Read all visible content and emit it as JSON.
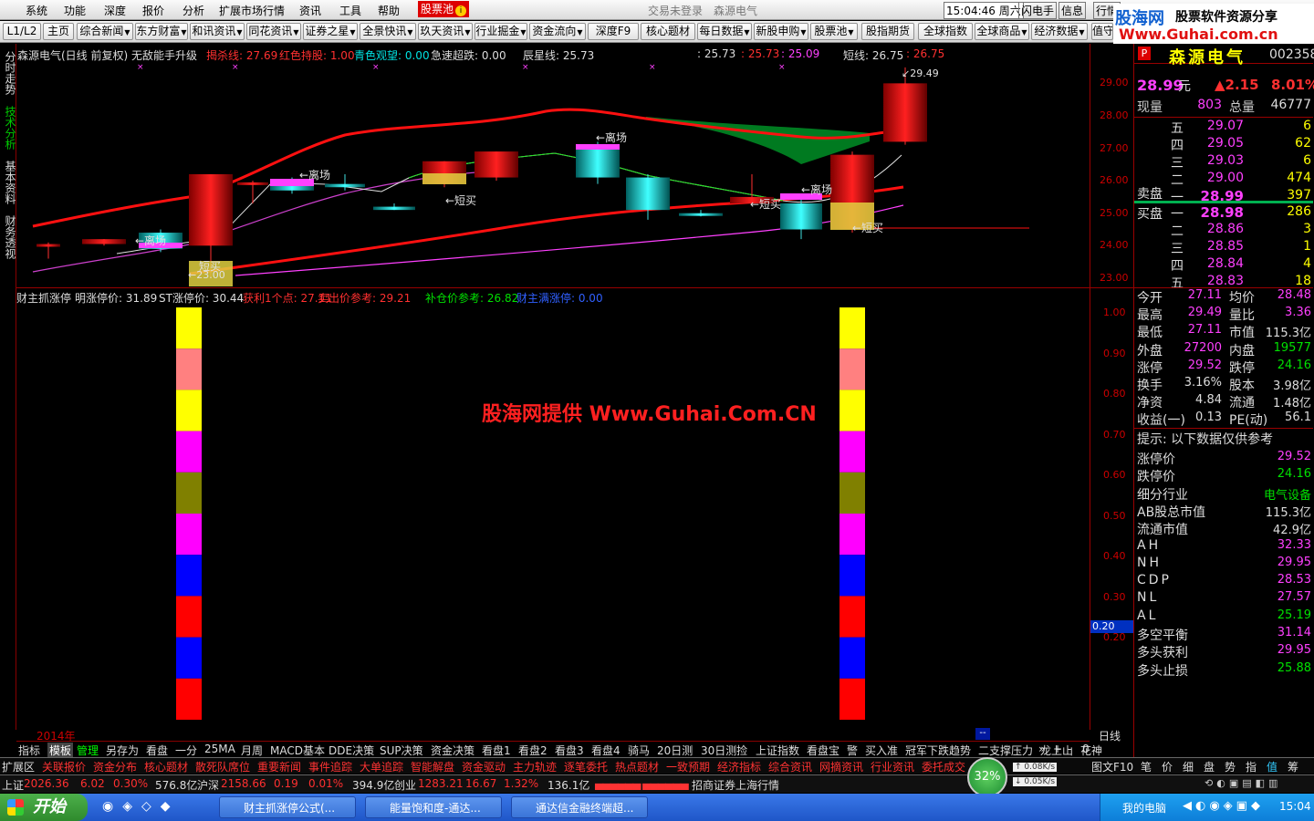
{
  "menu": {
    "items": [
      "系统",
      "功能",
      "深度",
      "报价",
      "分析",
      "扩展市场行情",
      "资讯",
      "工具",
      "帮助"
    ],
    "hot_item": "股票池",
    "center_status": "交易未登录",
    "center_stock": "森源电气",
    "time": "15:04:46 周六",
    "right_items": [
      "闪电手",
      "信息",
      "行情"
    ]
  },
  "toolbar": {
    "items": [
      "L1/L2",
      "主页",
      "综合新闻",
      "东方财富",
      "和讯资讯",
      "同花资讯",
      "证券之星",
      "全景快讯",
      "玖天资讯",
      "行业掘金",
      "资金流向",
      "深度F9",
      "核心题材",
      "每日数据",
      "新股申购",
      "股票池",
      "股指期货",
      "全球指数",
      "全球商品",
      "经济数据",
      "值守"
    ]
  },
  "logo": {
    "brand": "股海网",
    "slogan": "股票软件资源分享",
    "url": "Www.Guhai.com.cn"
  },
  "left_tabs": [
    "分时走势",
    "技术分析",
    "基本资料",
    "财务透视"
  ],
  "kline": {
    "header": [
      {
        "t": "森源电气(日线 前复权) 无敌能手升级",
        "c": "#ddd"
      },
      {
        "t": "揭杀线: 27.69",
        "c": "#ff3030"
      },
      {
        "t": "红色持股: 1.00",
        "c": "#ff3030"
      },
      {
        "t": "青色观望: 0.00",
        "c": "#00e0e0"
      },
      {
        "t": "急速超跌: 0.00",
        "c": "#ddd"
      },
      {
        "t": "辰星线: 25.73",
        "c": "#ddd"
      },
      {
        "t": ": 25.73",
        "c": "#ddd"
      },
      {
        "t": ": 25.73",
        "c": "#ff3030"
      },
      {
        "t": ": 25.09",
        "c": "#ff40ff"
      },
      {
        "t": "短线: 26.75",
        "c": "#ddd"
      },
      {
        "t": ": 26.75",
        "c": "#ff3030"
      }
    ],
    "axis_labels": [
      "29.00",
      "28.00",
      "27.00",
      "26.00",
      "25.00",
      "24.00",
      "23.00"
    ],
    "annotations": {
      "high": "29.49",
      "low": "23.00",
      "buy": "短买",
      "sell": "离场"
    }
  },
  "indicator": {
    "header": [
      {
        "t": "财主抓涨停",
        "c": "#ddd"
      },
      {
        "t": "明涨停价: 31.89",
        "c": "#ddd"
      },
      {
        "t": "ST涨停价: 30.44",
        "c": "#ddd"
      },
      {
        "t": "获利1个点: 27.11",
        "c": "#ff3030"
      },
      {
        "t": "卖出价参考: 29.21",
        "c": "#ff3030"
      },
      {
        "t": "补仓价参考: 26.82",
        "c": "#00e000"
      },
      {
        "t": "财主满涨停: 0.00",
        "c": "#3060ff"
      }
    ],
    "axis_labels": [
      "1.00",
      "0.90",
      "0.80",
      "0.70",
      "0.60",
      "0.50",
      "0.40",
      "0.30",
      "0.20"
    ],
    "current_value": "0.20",
    "stack_colors": [
      "#ffff00",
      "#ff8080",
      "#ffff00",
      "#ff00ff",
      "#808000",
      "#ff00ff",
      "#0000ff",
      "#ff0000",
      "#0000ff",
      "#ff0000"
    ]
  },
  "watermark": "股海网提供 Www.Guhai.Com.CN",
  "year_label": "2014年",
  "period": "日线",
  "quote": {
    "name": "森源电气",
    "code": "002358",
    "price": "28.99",
    "unit": "元",
    "change": "▲2.15",
    "pct": "8.01%",
    "xianliang_label": "现量",
    "xianliang": "803",
    "zongliang_label": "总量",
    "zongliang": "46777",
    "sells": [
      {
        "n": "五",
        "p": "29.07",
        "v": "6"
      },
      {
        "n": "四",
        "p": "29.05",
        "v": "62"
      },
      {
        "n": "三",
        "p": "29.03",
        "v": "6"
      },
      {
        "n": "二",
        "p": "29.00",
        "v": "474"
      },
      {
        "n": "一",
        "p": "28.99",
        "v": "397"
      }
    ],
    "sell_label": "卖盘",
    "buy_label": "买盘",
    "buys": [
      {
        "n": "一",
        "p": "28.98",
        "v": "286"
      },
      {
        "n": "二",
        "p": "28.86",
        "v": "3"
      },
      {
        "n": "三",
        "p": "28.85",
        "v": "1"
      },
      {
        "n": "四",
        "p": "28.84",
        "v": "4"
      },
      {
        "n": "五",
        "p": "28.83",
        "v": "18"
      }
    ],
    "stats": [
      [
        {
          "l": "今开",
          "v": "27.11",
          "c": "#ff40ff"
        },
        {
          "l": "均价",
          "v": "28.48",
          "c": "#ff40ff"
        }
      ],
      [
        {
          "l": "最高",
          "v": "29.49",
          "c": "#ff40ff"
        },
        {
          "l": "量比",
          "v": "3.36",
          "c": "#ff40ff"
        }
      ],
      [
        {
          "l": "最低",
          "v": "27.11",
          "c": "#ff40ff"
        },
        {
          "l": "市值",
          "v": "115.3亿",
          "c": "#ddd"
        }
      ],
      [
        {
          "l": "外盘",
          "v": "27200",
          "c": "#ff40ff"
        },
        {
          "l": "内盘",
          "v": "19577",
          "c": "#00e000"
        }
      ],
      [
        {
          "l": "涨停",
          "v": "29.52",
          "c": "#ff40ff"
        },
        {
          "l": "跌停",
          "v": "24.16",
          "c": "#00e000"
        }
      ],
      [
        {
          "l": "换手",
          "v": "3.16%",
          "c": "#ddd"
        },
        {
          "l": "股本",
          "v": "3.98亿",
          "c": "#ddd"
        }
      ],
      [
        {
          "l": "净资",
          "v": "4.84",
          "c": "#ddd"
        },
        {
          "l": "流通",
          "v": "1.48亿",
          "c": "#ddd"
        }
      ],
      [
        {
          "l": "收益(一)",
          "v": "0.13",
          "c": "#ddd"
        },
        {
          "l": "PE(动)",
          "v": "56.1",
          "c": "#ddd"
        }
      ]
    ],
    "hint": "提示: 以下数据仅供参考",
    "extra": [
      {
        "l": "涨停价",
        "v": "29.52",
        "c": "#ff40ff"
      },
      {
        "l": "跌停价",
        "v": "24.16",
        "c": "#00e000"
      },
      {
        "l": "细分行业",
        "v": "电气设备",
        "c": "#00e000"
      },
      {
        "l": "AB股总市值",
        "v": "115.3亿",
        "c": "#ddd"
      },
      {
        "l": "流通市值",
        "v": "42.9亿",
        "c": "#ddd"
      },
      {
        "l": "AH",
        "v": "32.33",
        "c": "#ff40ff"
      },
      {
        "l": "NH",
        "v": "29.95",
        "c": "#ff40ff"
      },
      {
        "l": "CDP",
        "v": "28.53",
        "c": "#ff40ff"
      },
      {
        "l": "NL",
        "v": "27.57",
        "c": "#ff40ff"
      },
      {
        "l": "AL",
        "v": "25.19",
        "c": "#00e000"
      },
      {
        "l": "多空平衡",
        "v": "31.14",
        "c": "#ff40ff"
      },
      {
        "l": "多头获利",
        "v": "29.95",
        "c": "#ff40ff"
      },
      {
        "l": "多头止损",
        "v": "25.88",
        "c": "#00e000"
      }
    ]
  },
  "bottom_tabs1": [
    "指标",
    "模板",
    "管理",
    "另存为",
    "看盘",
    "一分",
    "25MA",
    "月周",
    "MACD基本",
    "DDE决策",
    "SUP决策",
    "资金决策",
    "看盘1",
    "看盘2",
    "看盘3",
    "看盘4",
    "骑马",
    "20日测",
    "30日测捡",
    "上证指数",
    "看盘宝",
    "警",
    "买入准",
    "冠军下跌趋势",
    "二支撑压力",
    "龙上山",
    "花神"
  ],
  "bottom_tabs1_right": [
    "»",
    "+",
    "-",
    "0"
  ],
  "bottom_tabs2": [
    "扩展区",
    "关联报价",
    "资金分布",
    "核心题材",
    "散死队席位",
    "重要新闻",
    "事件追踪",
    "大单追踪",
    "智能解盘",
    "资金驱动",
    "主力轨迹",
    "逐笔委托",
    "热点题材",
    "一致预期",
    "经济指标",
    "综合资讯",
    "网摘资讯",
    "行业资讯",
    "委托成交"
  ],
  "bottom_tabs2_right": [
    "图文F10",
    "笔",
    "价",
    "细",
    "盘",
    "势",
    "指",
    "值",
    "筹"
  ],
  "status": {
    "sh_label": "上证",
    "sh": "2026.36",
    "sh_chg": "6.02",
    "sh_pct": "0.30%",
    "sh_amt": "576.8亿",
    "sz_label": "沪深",
    "sz": "2158.66",
    "sz_chg": "0.19",
    "sz_pct": "0.01%",
    "sz_amt": "394.9亿",
    "cy_label": "创业",
    "cy": "1283.21",
    "cy_chg": "16.67",
    "cy_pct": "1.32%",
    "cy_amt": "136.1亿",
    "broker": "招商证券上海行情",
    "net_pct": "32%",
    "up_speed": "0.08K/s",
    "down_speed": "0.05K/s"
  },
  "taskbar": {
    "start": "开始",
    "tasks": [
      "财主抓涨停公式(...",
      "能量饱和度-通达...",
      "通达信金融终端超..."
    ],
    "my_computer": "我的电脑",
    "clock": "15:04"
  },
  "chart_data": {
    "type": "candlestick",
    "ylim": [
      22.8,
      29.6
    ],
    "candles": [
      {
        "o": 24.0,
        "c": 24.05,
        "h": 24.1,
        "l": 23.6,
        "col": "red"
      },
      {
        "o": 24.05,
        "c": 24.2,
        "h": 24.2,
        "l": 24.0,
        "col": "red"
      },
      {
        "o": 24.4,
        "c": 23.9,
        "h": 24.5,
        "l": 23.8,
        "col": "cyan"
      },
      {
        "o": 24.0,
        "c": 26.2,
        "h": 26.2,
        "l": 23.0,
        "col": "red"
      },
      {
        "o": 25.9,
        "c": 25.95,
        "h": 26.0,
        "l": 25.3,
        "col": "red"
      },
      {
        "o": 26.0,
        "c": 25.7,
        "h": 26.1,
        "l": 25.6,
        "col": "cyan"
      },
      {
        "o": 25.9,
        "c": 25.8,
        "h": 26.2,
        "l": 25.7,
        "col": "cyan"
      },
      {
        "o": 25.2,
        "c": 25.1,
        "h": 25.3,
        "l": 25.1,
        "col": "cyan"
      },
      {
        "o": 25.9,
        "c": 26.6,
        "h": 26.6,
        "l": 25.8,
        "col": "red"
      },
      {
        "o": 26.1,
        "c": 26.9,
        "h": 26.9,
        "l": 26.0,
        "col": "red"
      },
      {
        "o": 27.0,
        "c": 26.1,
        "h": 27.2,
        "l": 25.9,
        "col": "cyan"
      },
      {
        "o": 26.1,
        "c": 25.1,
        "h": 26.2,
        "l": 24.8,
        "col": "cyan"
      },
      {
        "o": 25.0,
        "c": 24.95,
        "h": 25.1,
        "l": 24.9,
        "col": "cyan"
      },
      {
        "o": 25.3,
        "c": 25.5,
        "h": 26.2,
        "l": 25.3,
        "col": "red"
      },
      {
        "o": 25.3,
        "c": 24.5,
        "h": 25.6,
        "l": 24.2,
        "col": "cyan"
      },
      {
        "o": 24.5,
        "c": 26.8,
        "h": 26.9,
        "l": 24.4,
        "col": "red"
      },
      {
        "o": 27.2,
        "c": 29.0,
        "h": 29.49,
        "l": 27.11,
        "col": "red"
      }
    ]
  }
}
